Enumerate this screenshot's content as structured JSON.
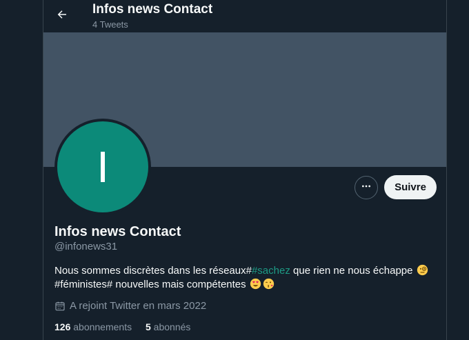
{
  "header": {
    "title": "Infos news Contact",
    "subtitle": "4 Tweets",
    "back_icon": "arrow-left-icon"
  },
  "profile": {
    "avatar_letter": "I",
    "name": "Infos news Contact",
    "handle": "@infonews31",
    "bio": {
      "part1": "Nous sommes discrètes dans les réseaux#",
      "hashtag": "#sachez",
      "part2": " que rien ne nous échappe ",
      "part3": "#féministes# nouvelles mais compétentes "
    },
    "joined": "A rejoint Twitter en mars 2022",
    "following_count": "126",
    "following_label": "abonnements",
    "followers_count": "5",
    "followers_label": "abonnés"
  },
  "actions": {
    "follow_label": "Suivre",
    "more_icon": "more-dots-icon"
  },
  "colors": {
    "background": "#15202b",
    "banner": "#425364",
    "avatar": "#0c8a79",
    "hashtag": "#1d9b85",
    "muted": "#8b98a5"
  }
}
